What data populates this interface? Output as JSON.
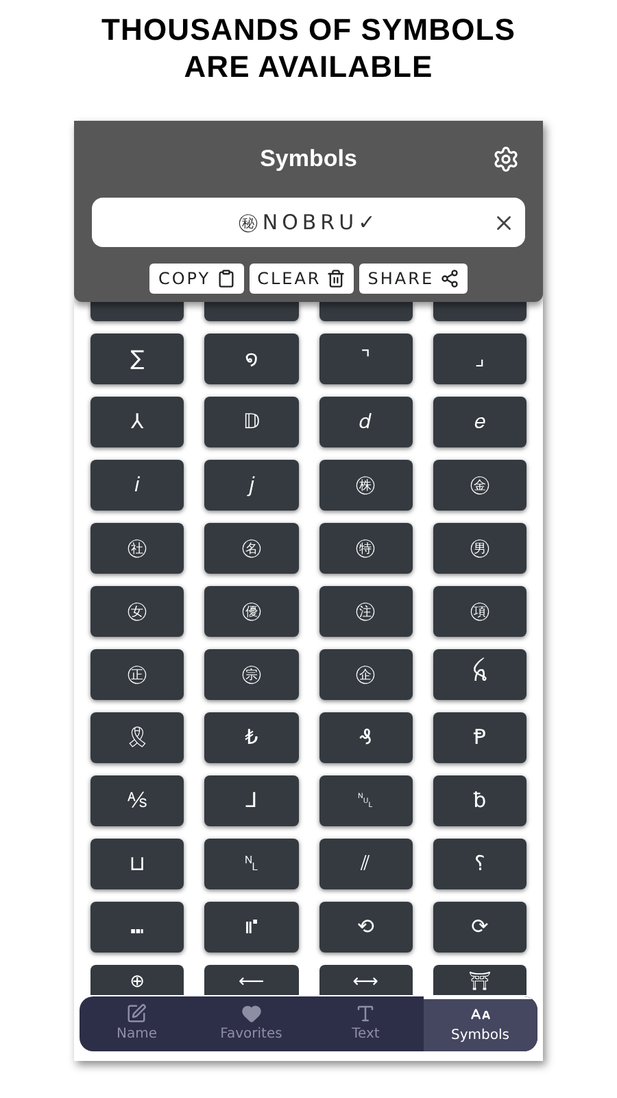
{
  "headline": [
    "THOUSANDS OF SYMBOLS",
    "ARE AVAILABLE"
  ],
  "app": {
    "title": "Symbols",
    "input": {
      "value": "㊙NOBRU✓"
    },
    "actions": [
      {
        "label": "COPY",
        "kind": "copy"
      },
      {
        "label": "CLEAR",
        "kind": "clear"
      },
      {
        "label": "SHARE",
        "kind": "share"
      }
    ]
  },
  "symbols": [
    "∑",
    "໑",
    "⌝",
    "⌟",
    "⅄",
    "𝔻",
    "𝑑",
    "𝑒",
    "𝑖",
    "𝑗",
    "㊑",
    "㊎",
    "㊓",
    "㊔",
    "㊕",
    "㊚",
    "㊛",
    "㊝",
    "㊟",
    "㊠",
    "㊣",
    "㊪",
    "㊭",
    "ꫝ",
    "🎗",
    "₺",
    "₰",
    "Ᵽ",
    "⅍",
    "⅃",
    "␀",
    "ƀ",
    "⊔",
    "␤",
    "⫽",
    "⸮",
    "⑉",
    "⑈",
    "⟲",
    "⟳",
    "⊕",
    "⟵",
    "⟷",
    "⛩"
  ],
  "nav": [
    {
      "label": "Name",
      "kind": "name",
      "selected": false
    },
    {
      "label": "Favorites",
      "kind": "favorites",
      "selected": false
    },
    {
      "label": "Text",
      "kind": "text",
      "selected": false
    },
    {
      "label": "Symbols",
      "kind": "symbols",
      "selected": true
    }
  ]
}
